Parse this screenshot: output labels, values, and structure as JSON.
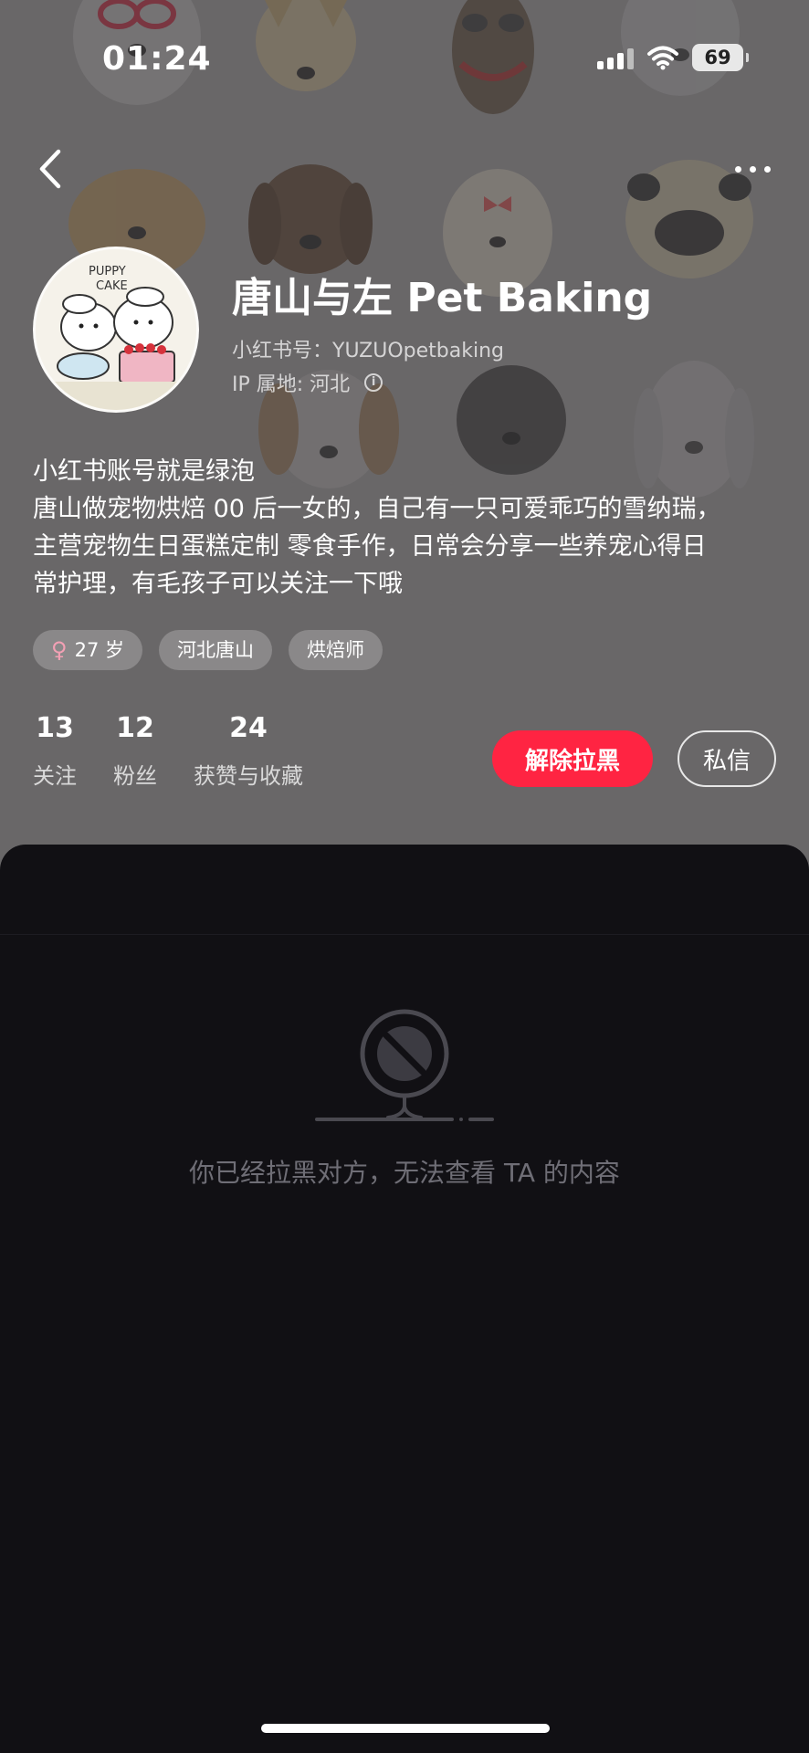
{
  "status_bar": {
    "time": "01:24",
    "battery": "69"
  },
  "profile": {
    "name": "唐山与左 Pet Baking",
    "id_line": "小红书号：YUZUOpetbaking",
    "ip_line": "IP 属地: 河北",
    "bio": [
      "小红书账号就是绿泡",
      "唐山做宠物烘焙 00 后一女的，自己有一只可爱乖巧的雪纳瑞，",
      "主营宠物生日蛋糕定制 零食手作，日常会分享一些养宠心得日",
      "常护理，有毛孩子可以关注一下哦"
    ],
    "tags": [
      "27 岁",
      "河北唐山",
      "烘焙师"
    ],
    "avatar_lettering": [
      "PUPPY",
      "CAKE"
    ]
  },
  "stats": [
    {
      "num": "13",
      "label": "关注"
    },
    {
      "num": "12",
      "label": "粉丝"
    },
    {
      "num": "24",
      "label": "获赞与收藏"
    }
  ],
  "actions": {
    "unblock": "解除拉黑",
    "message": "私信"
  },
  "content": {
    "blocked_message": "你已经拉黑对方，无法查看 TA 的内容"
  },
  "colors": {
    "accent": "#ff2442",
    "sheet_bg": "#111014",
    "muted_text": "#6f6e76"
  },
  "icons": [
    "back-icon",
    "more-icon",
    "signal-icon",
    "wifi-icon",
    "battery-icon",
    "info-icon",
    "female-icon",
    "blocked-icon"
  ]
}
